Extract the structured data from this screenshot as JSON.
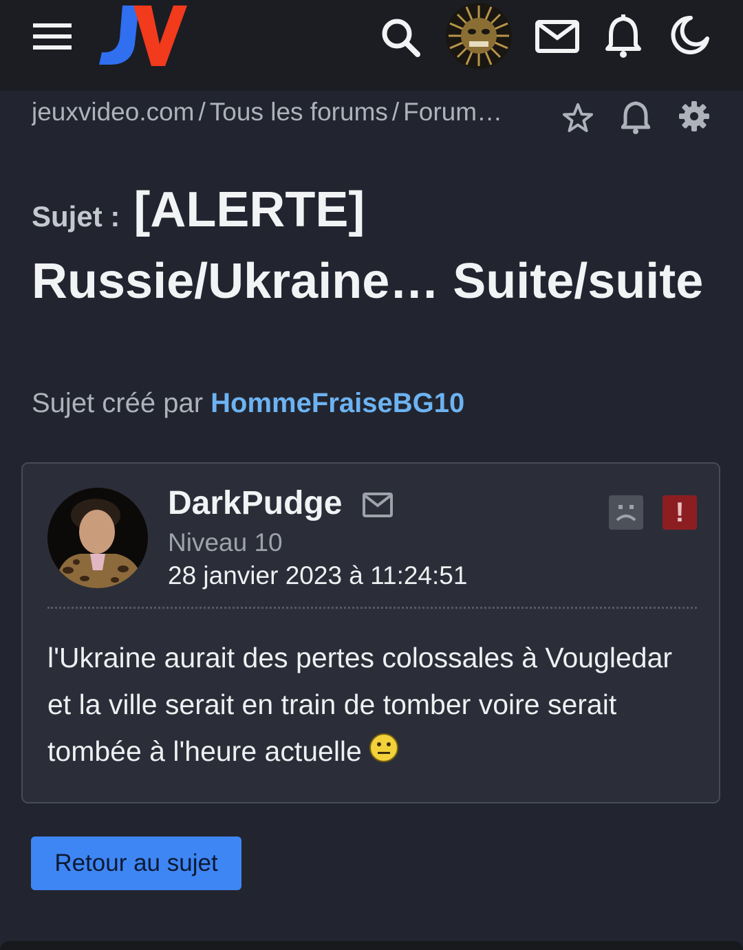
{
  "header": {
    "logo_letter_j": "J",
    "logo_letter_v": "V",
    "icons": [
      "menu-icon",
      "search-icon",
      "user-avatar",
      "mail-icon",
      "bell-icon",
      "moon-icon"
    ]
  },
  "breadcrumb": {
    "items": [
      "jeuxvideo.com",
      "Tous les forums",
      "Forum…"
    ],
    "separator": "/",
    "icons": [
      "star-icon",
      "bell-icon",
      "gear-icon"
    ]
  },
  "topic": {
    "prefix": "Sujet :",
    "title_line1": "[ALERTE]",
    "title_line2": "Russie/Ukraine… Suite/suite"
  },
  "creator": {
    "label": "Sujet créé par",
    "author": "HommeFraiseBG10"
  },
  "post": {
    "author": "DarkPudge",
    "level": "Niveau 10",
    "date": "28 janvier 2023 à 11:24:51",
    "alert_symbol": "!",
    "body": "l'Ukraine aurait des pertes colossales à Vougledar et la ville serait en train de tomber voire serait tombée à l'heure actuelle"
  },
  "actions": {
    "back_label": "Retour au sujet"
  },
  "colors": {
    "background": "#22252f",
    "topbar": "#1b1d22",
    "author_link": "#6db3f2",
    "button": "#3f86f5",
    "logo_j": "#2f6ff0",
    "logo_v": "#f23a1c",
    "alert": "#8c1e22"
  }
}
